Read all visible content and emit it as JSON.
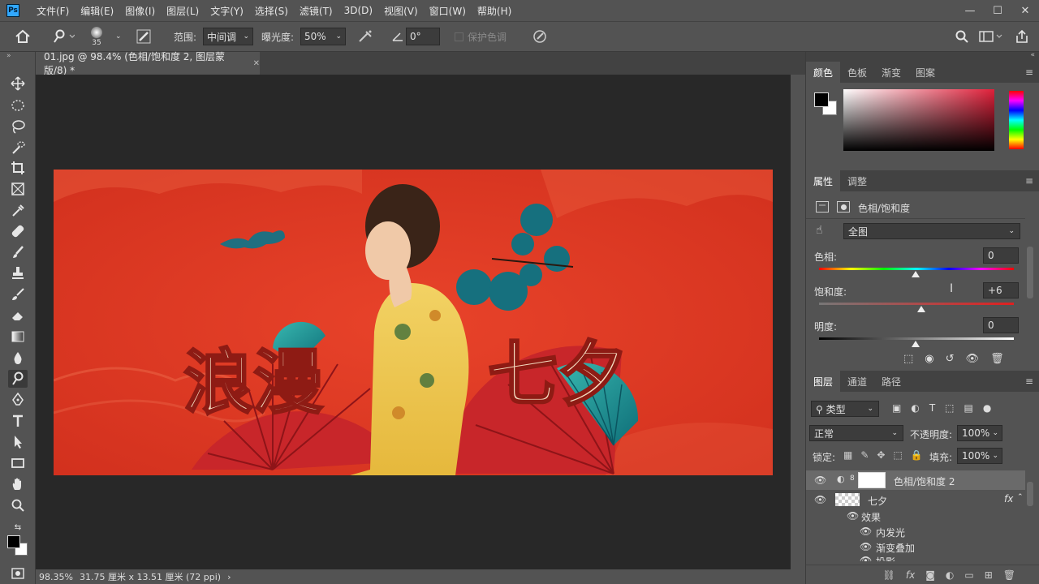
{
  "menu": {
    "logo": "Ps",
    "items": [
      "文件(F)",
      "编辑(E)",
      "图像(I)",
      "图层(L)",
      "文字(Y)",
      "选择(S)",
      "滤镜(T)",
      "3D(D)",
      "视图(V)",
      "窗口(W)",
      "帮助(H)"
    ]
  },
  "options": {
    "brush_size": "35",
    "range_label": "范围:",
    "range_value": "中间调",
    "exposure_label": "曝光度:",
    "exposure_value": "50%",
    "angle_value": "0°",
    "protect_tones": "保护色调"
  },
  "document": {
    "tab_title": "01.jpg @ 98.4% (色相/饱和度 2, 图层蒙版/8) *",
    "zoom": "98.35%",
    "dimensions": "31.75 厘米 x 13.51 厘米 (72 ppi)"
  },
  "color_panel": {
    "tabs": [
      "颜色",
      "色板",
      "渐变",
      "图案"
    ],
    "foreground": "#000000",
    "background": "#ffffff",
    "hue_color": "#e0203a"
  },
  "properties_panel": {
    "tabs": [
      "属性",
      "调整"
    ],
    "title": "色相/饱和度",
    "preset": "全图",
    "hue_label": "色相:",
    "hue_value": "0",
    "saturation_label": "饱和度:",
    "saturation_value": "+6",
    "lightness_label": "明度:",
    "lightness_value": "0"
  },
  "layers_panel": {
    "tabs": [
      "图层",
      "通道",
      "路径"
    ],
    "filter_kind": "类型",
    "blend_mode": "正常",
    "opacity_label": "不透明度:",
    "opacity_value": "100%",
    "lock_label": "锁定:",
    "fill_label": "填充:",
    "fill_value": "100%",
    "layers": [
      {
        "name": "色相/饱和度 2"
      },
      {
        "name": "七夕"
      }
    ],
    "effects_label": "效果",
    "effects": [
      "内发光",
      "渐变叠加",
      "投影"
    ]
  },
  "artwork": {
    "title_left": "浪漫",
    "title_right": "七夕"
  }
}
